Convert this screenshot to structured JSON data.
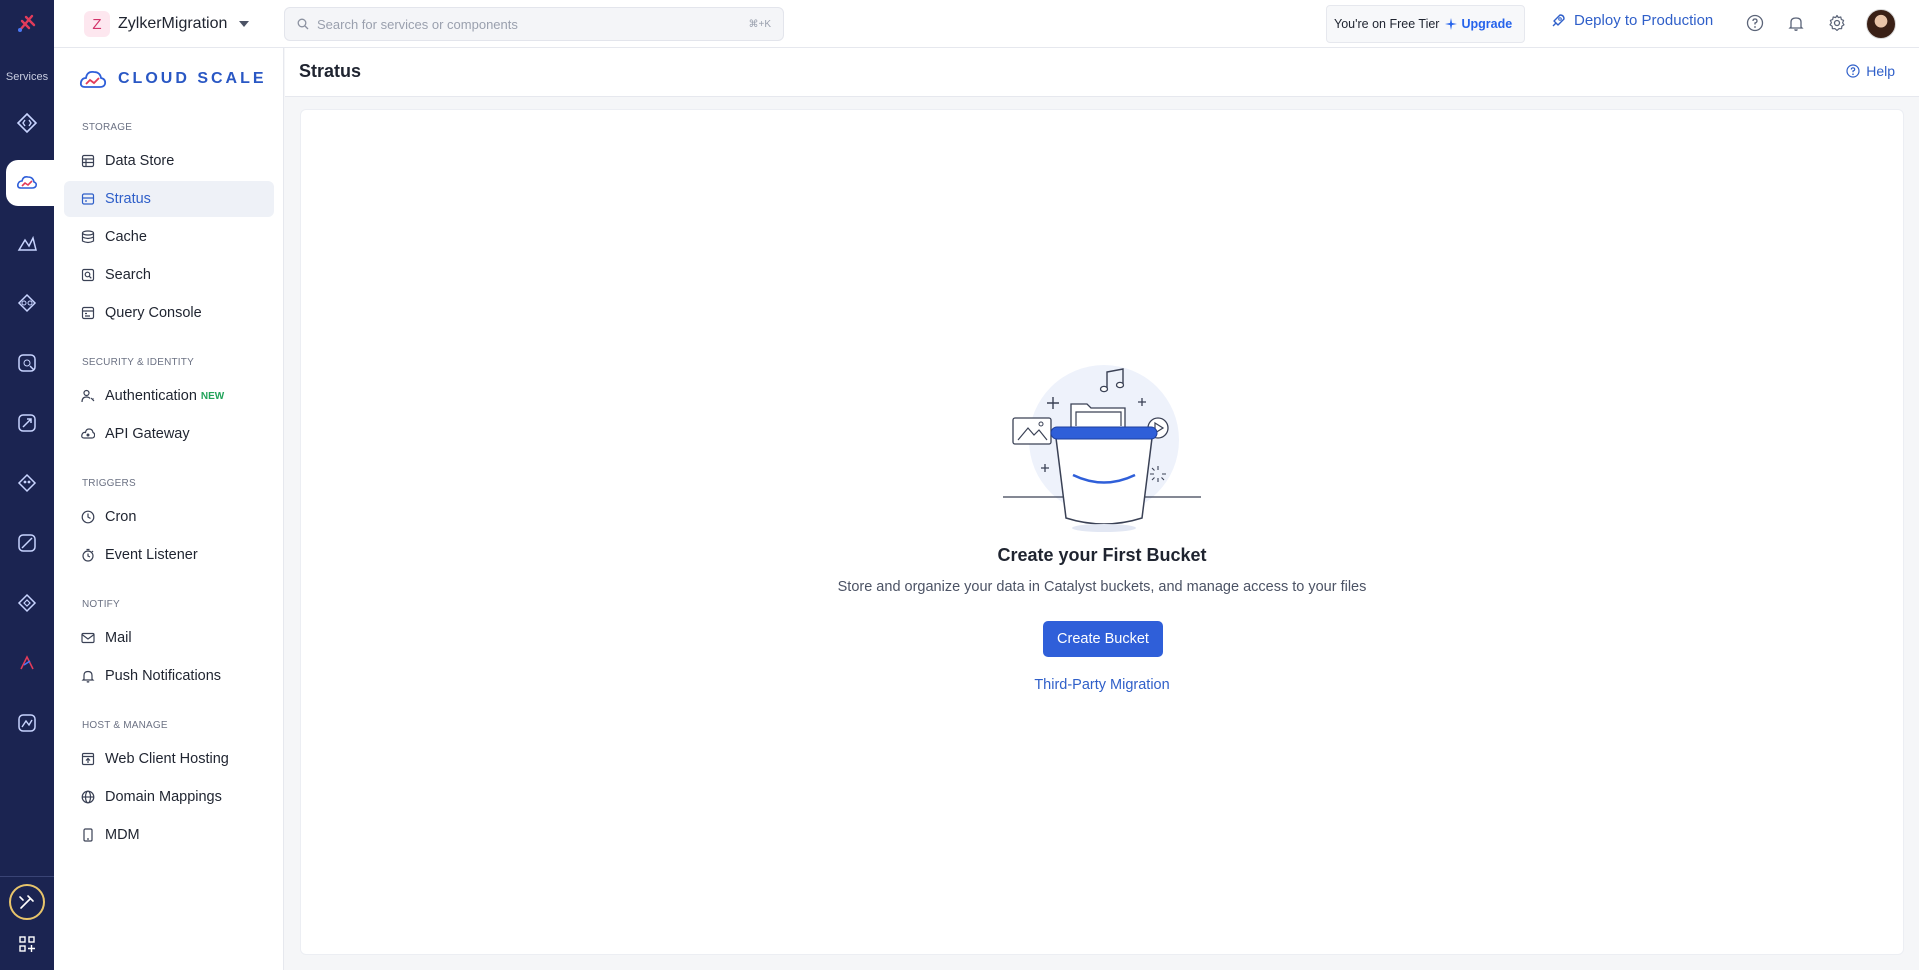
{
  "topbar": {
    "project_initial": "Z",
    "project_name": "ZylkerMigration",
    "search_placeholder": "Search for services or components",
    "search_shortcut": "⌘+K",
    "tier_text": "You're on Free Tier",
    "upgrade_label": "Upgrade",
    "deploy_label": "Deploy to Production"
  },
  "rail": {
    "services_label": "Services"
  },
  "sidebar": {
    "brand": "CLOUD SCALE",
    "sections": [
      {
        "label": "STORAGE"
      },
      {
        "label": "SECURITY & IDENTITY"
      },
      {
        "label": "TRIGGERS"
      },
      {
        "label": "NOTIFY"
      },
      {
        "label": "HOST & MANAGE"
      }
    ],
    "items": [
      {
        "label": "Data Store"
      },
      {
        "label": "Stratus"
      },
      {
        "label": "Cache"
      },
      {
        "label": "Search"
      },
      {
        "label": "Query Console"
      },
      {
        "label": "Authentication",
        "tag": "NEW"
      },
      {
        "label": "API Gateway"
      },
      {
        "label": "Cron"
      },
      {
        "label": "Event Listener"
      },
      {
        "label": "Mail"
      },
      {
        "label": "Push Notifications"
      },
      {
        "label": "Web Client Hosting"
      },
      {
        "label": "Domain Mappings"
      },
      {
        "label": "MDM"
      }
    ],
    "active_item": "Stratus"
  },
  "main": {
    "title": "Stratus",
    "help_label": "Help",
    "empty_title": "Create your First Bucket",
    "empty_description": "Store and organize your data in Catalyst buckets, and manage access to your files",
    "create_button": "Create Bucket",
    "migration_link": "Third-Party Migration"
  },
  "colors": {
    "rail_bg": "#1b2451",
    "accent": "#2f5fd9",
    "link": "#2f5fc9",
    "new_tag": "#22a35a"
  }
}
